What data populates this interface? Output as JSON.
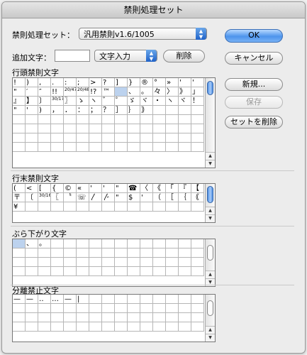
{
  "window": {
    "title": "禁則処理セット"
  },
  "set_row": {
    "label": "禁則処理セット：",
    "selected": "汎用禁則v1.6/1005"
  },
  "add_row": {
    "label": "追加文字：",
    "value": "",
    "mode_selected": "文字入力",
    "delete_label": "削除"
  },
  "buttons": {
    "ok": "OK",
    "cancel": "キャンセル",
    "new": "新規...",
    "save": "保存",
    "delete_set": "セットを削除"
  },
  "sections": {
    "head": {
      "title": "行頭禁則文字"
    },
    "tail": {
      "title": "行末禁則文字"
    },
    "hang": {
      "title": "ぶら下がり文字"
    },
    "nosplit": {
      "title": "分離禁止文字"
    }
  },
  "head_chars": [
    [
      "!",
      ")",
      ",",
      ".",
      ":",
      ";",
      ">",
      "?",
      "]",
      "}",
      "®",
      "°",
      "»",
      "'",
      "'"
    ],
    [
      "\"",
      "′",
      "″",
      "!!",
      "20/47",
      "20/48",
      "!?",
      "™",
      "",
      "、",
      "。",
      "々",
      "〉",
      "》",
      "」"
    ],
    [
      "』",
      "】",
      "〕",
      "30/17",
      "〗",
      "ゝ",
      "ヽ",
      "゛",
      "゜",
      "ゞ",
      "ヾ",
      "・",
      "ヽ",
      "ヾ",
      "！"
    ],
    [
      "\"",
      "'",
      ")",
      "，",
      "．",
      "：",
      "；",
      "？",
      "］",
      "｝",
      "｠",
      "",
      "",
      "",
      ""
    ],
    [
      "",
      "",
      "",
      "",
      "",
      "",
      "",
      "",
      "",
      "",
      "",
      "",
      "",
      "",
      ""
    ],
    [
      "",
      "",
      "",
      "",
      "",
      "",
      "",
      "",
      "",
      "",
      "",
      "",
      "",
      "",
      ""
    ],
    [
      "",
      "",
      "",
      "",
      "",
      "",
      "",
      "",
      "",
      "",
      "",
      "",
      "",
      "",
      ""
    ],
    [
      "",
      "",
      "",
      "",
      "",
      "",
      "",
      "",
      "",
      "",
      "",
      "",
      "",
      "",
      ""
    ]
  ],
  "tail_chars": [
    [
      "(",
      "<",
      "[",
      "{",
      "©",
      "«",
      "'",
      "'",
      "\"",
      "☎",
      "〈",
      "《",
      "「",
      "『",
      "【"
    ],
    [
      "〒",
      "〔",
      "30/16",
      "〖",
      "〝",
      "☏",
      "〳",
      "〴",
      "\"",
      "$",
      "'",
      "（",
      "［",
      "｛",
      "｟"
    ],
    [
      "¥",
      "",
      "",
      "",
      "",
      "",
      "",
      "",
      "",
      "",
      "",
      "",
      "",
      "",
      ""
    ]
  ],
  "hang_chars": [
    [
      "",
      "、",
      "。",
      "",
      "",
      "",
      "",
      "",
      "",
      "",
      "",
      "",
      "",
      "",
      ""
    ],
    [
      "",
      "",
      "",
      "",
      "",
      "",
      "",
      "",
      "",
      "",
      "",
      "",
      "",
      "",
      ""
    ],
    [
      "",
      "",
      "",
      "",
      "",
      "",
      "",
      "",
      "",
      "",
      "",
      "",
      "",
      "",
      ""
    ],
    [
      "",
      "",
      "",
      "",
      "",
      "",
      "",
      "",
      "",
      "",
      "",
      "",
      "",
      "",
      ""
    ]
  ],
  "nosplit_chars": [
    [
      "—",
      "—",
      "‥",
      "…",
      "—",
      "|",
      "",
      "",
      "",
      "",
      "",
      "",
      "",
      "",
      ""
    ],
    [
      "",
      "",
      "",
      "",
      "",
      "",
      "",
      "",
      "",
      "",
      "",
      "",
      "",
      "",
      ""
    ],
    [
      "",
      "",
      "",
      "",
      "",
      "",
      "",
      "",
      "",
      "",
      "",
      "",
      "",
      "",
      ""
    ],
    [
      "",
      "",
      "",
      "",
      "",
      "",
      "",
      "",
      "",
      "",
      "",
      "",
      "",
      "",
      ""
    ]
  ],
  "colors": {
    "selection": "#bcd2ee",
    "accent": "#4d94ec"
  }
}
